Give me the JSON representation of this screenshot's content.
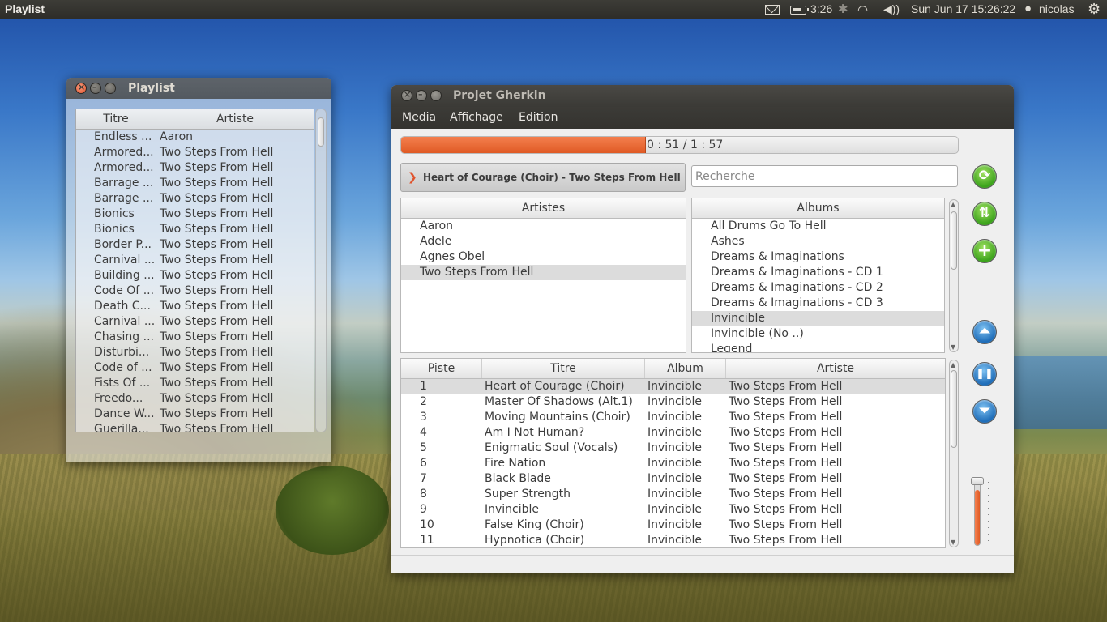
{
  "top_panel": {
    "app_title": "Playlist",
    "battery": "3:26",
    "clock": "Sun Jun 17 15:26:22",
    "user": "nicolas"
  },
  "playlist_window": {
    "title": "Playlist",
    "columns": [
      "Titre",
      "Artiste"
    ],
    "rows": [
      {
        "titre": "Endless ...",
        "artiste": "Aaron"
      },
      {
        "titre": "Armored...",
        "artiste": "Two Steps From Hell"
      },
      {
        "titre": "Armored...",
        "artiste": "Two Steps From Hell"
      },
      {
        "titre": "Barrage ...",
        "artiste": "Two Steps From Hell"
      },
      {
        "titre": "Barrage ...",
        "artiste": "Two Steps From Hell"
      },
      {
        "titre": "Bionics",
        "artiste": "Two Steps From Hell"
      },
      {
        "titre": "Bionics",
        "artiste": "Two Steps From Hell"
      },
      {
        "titre": "Border P...",
        "artiste": "Two Steps From Hell"
      },
      {
        "titre": "Carnival ...",
        "artiste": "Two Steps From Hell"
      },
      {
        "titre": "Building ...",
        "artiste": "Two Steps From Hell"
      },
      {
        "titre": "Code Of ...",
        "artiste": "Two Steps From Hell"
      },
      {
        "titre": "Death C...",
        "artiste": "Two Steps From Hell"
      },
      {
        "titre": "Carnival ...",
        "artiste": "Two Steps From Hell"
      },
      {
        "titre": "Chasing ...",
        "artiste": "Two Steps From Hell"
      },
      {
        "titre": "Disturbi...",
        "artiste": "Two Steps From Hell"
      },
      {
        "titre": "Code of ...",
        "artiste": "Two Steps From Hell"
      },
      {
        "titre": "Fists Of ...",
        "artiste": "Two Steps From Hell"
      },
      {
        "titre": "Freedo...",
        "artiste": "Two Steps From Hell"
      },
      {
        "titre": "Dance W...",
        "artiste": "Two Steps From Hell"
      },
      {
        "titre": "Guerilla...",
        "artiste": "Two Steps From Hell"
      }
    ]
  },
  "main_window": {
    "title": "Projet Gherkin",
    "menu": [
      "Media",
      "Affichage",
      "Edition"
    ],
    "progress": {
      "fraction": 0.44,
      "time": "0 : 51 / 1 : 57"
    },
    "now_playing": "Heart of Courage (Choir) - Two Steps From Hell",
    "search": {
      "placeholder": "Recherche",
      "value": ""
    },
    "artists_header": "Artistes",
    "artists": [
      "Aaron",
      "Adele",
      "Agnes Obel",
      "Two Steps From Hell"
    ],
    "selected_artist_index": 3,
    "albums_header": "Albums",
    "albums": [
      "All Drums Go To Hell",
      "Ashes",
      "Dreams & Imaginations",
      "Dreams & Imaginations - CD 1",
      "Dreams & Imaginations - CD 2",
      "Dreams & Imaginations - CD 3",
      "Invincible",
      "Invincible (No ..)",
      "Legend"
    ],
    "selected_album_index": 6,
    "track_columns": [
      "Piste",
      "Titre",
      "Album",
      "Artiste"
    ],
    "tracks": [
      {
        "n": "1",
        "titre": "Heart of Courage (Choir)",
        "album": "Invincible",
        "artiste": "Two Steps From Hell"
      },
      {
        "n": "2",
        "titre": "Master Of Shadows (Alt.1)",
        "album": "Invincible",
        "artiste": "Two Steps From Hell"
      },
      {
        "n": "3",
        "titre": "Moving Mountains (Choir)",
        "album": "Invincible",
        "artiste": "Two Steps From Hell"
      },
      {
        "n": "4",
        "titre": "Am I Not Human?",
        "album": "Invincible",
        "artiste": "Two Steps From Hell"
      },
      {
        "n": "5",
        "titre": "Enigmatic Soul (Vocals)",
        "album": "Invincible",
        "artiste": "Two Steps From Hell"
      },
      {
        "n": "6",
        "titre": "Fire Nation",
        "album": "Invincible",
        "artiste": "Two Steps From Hell"
      },
      {
        "n": "7",
        "titre": "Black Blade",
        "album": "Invincible",
        "artiste": "Two Steps From Hell"
      },
      {
        "n": "8",
        "titre": "Super Strength",
        "album": "Invincible",
        "artiste": "Two Steps From Hell"
      },
      {
        "n": "9",
        "titre": "Invincible",
        "album": "Invincible",
        "artiste": "Two Steps From Hell"
      },
      {
        "n": "10",
        "titre": "False King (Choir)",
        "album": "Invincible",
        "artiste": "Two Steps From Hell"
      },
      {
        "n": "11",
        "titre": "Hypnotica (Choir)",
        "album": "Invincible",
        "artiste": "Two Steps From Hell"
      }
    ],
    "selected_track_index": 0,
    "side_buttons": [
      "refresh-icon",
      "sync-icon",
      "add-icon",
      "move-up-icon",
      "pause-icon",
      "move-down-icon"
    ],
    "volume_level": 0.85,
    "colors": {
      "accent": "#e05a24",
      "green": "#3aa21a",
      "blue": "#1d6cb8"
    }
  }
}
